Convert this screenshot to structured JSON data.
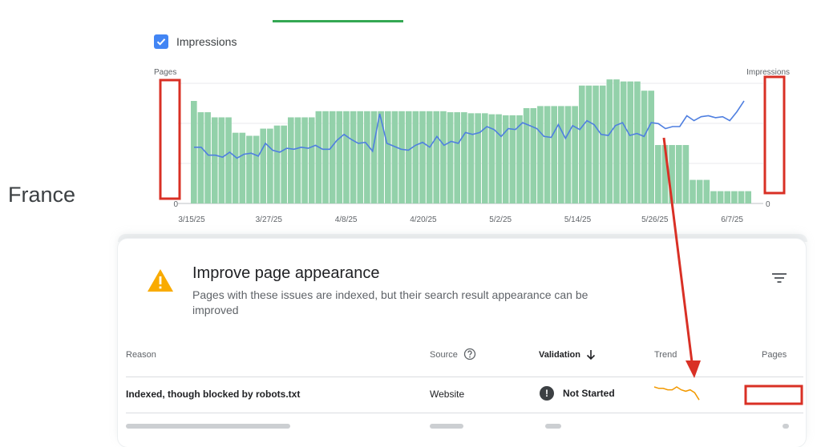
{
  "legend": {
    "label": "Impressions",
    "checked": true,
    "color": "#4285f4"
  },
  "country": "France",
  "chart_data": {
    "type": "bar",
    "left_axis_label": "Pages",
    "right_axis_label": "Impressions",
    "x_ticks": [
      "3/15/25",
      "3/27/25",
      "4/8/25",
      "4/20/25",
      "5/2/25",
      "5/14/25",
      "5/26/25",
      "6/7/25"
    ],
    "left_zero_label": "0",
    "right_zero_label": "0",
    "series": [
      {
        "name": "Pages",
        "color": "#93d1aa",
        "values": [
          100,
          89,
          89,
          84,
          84,
          84,
          69,
          69,
          66,
          66,
          73,
          73,
          76,
          76,
          84,
          84,
          84,
          84,
          90,
          90,
          90,
          90,
          90,
          90,
          90,
          90,
          90,
          90,
          90,
          90,
          90,
          90,
          90,
          90,
          90,
          90,
          90,
          89,
          89,
          89,
          88,
          88,
          88,
          87,
          87,
          86,
          86,
          86,
          93,
          93,
          95,
          95,
          95,
          95,
          95,
          95,
          115,
          115,
          115,
          115,
          121,
          121,
          119,
          119,
          119,
          110,
          110,
          57,
          57,
          57,
          57,
          57,
          23,
          23,
          23,
          12,
          12,
          12,
          12,
          12,
          12
        ]
      },
      {
        "name": "Impressions",
        "color": "#4f7fe0",
        "values": [
          57,
          57,
          49,
          49,
          47,
          52,
          46,
          50,
          51,
          48,
          61,
          54,
          52,
          56,
          55,
          57,
          56,
          59,
          55,
          55,
          64,
          70,
          65,
          61,
          62,
          53,
          91,
          61,
          58,
          55,
          54,
          59,
          62,
          57,
          68,
          59,
          63,
          61,
          72,
          70,
          72,
          78,
          75,
          68,
          76,
          75,
          82,
          79,
          76,
          68,
          67,
          80,
          66,
          79,
          75,
          84,
          80,
          70,
          69,
          79,
          82,
          69,
          71,
          68,
          82,
          81,
          76,
          78,
          78,
          89,
          84,
          88,
          89,
          87,
          88,
          84,
          93,
          104
        ]
      }
    ]
  },
  "panel": {
    "title": "Improve page appearance",
    "subtitle": "Pages with these issues are indexed, but their search result appearance can be improved",
    "columns": {
      "reason": "Reason",
      "source": "Source",
      "validation": "Validation",
      "trend": "Trend",
      "pages": "Pages"
    },
    "rows": [
      {
        "reason": "Indexed, though blocked by robots.txt",
        "source": "Website",
        "validation": "Not Started",
        "trend": [
          5,
          4,
          4,
          3,
          3,
          5,
          3,
          2,
          3,
          1,
          -4
        ]
      }
    ]
  },
  "colors": {
    "accent_green": "#34a853",
    "annotation_red": "#d93025",
    "warning_yellow": "#f9ab00",
    "trend_orange": "#f29900"
  }
}
